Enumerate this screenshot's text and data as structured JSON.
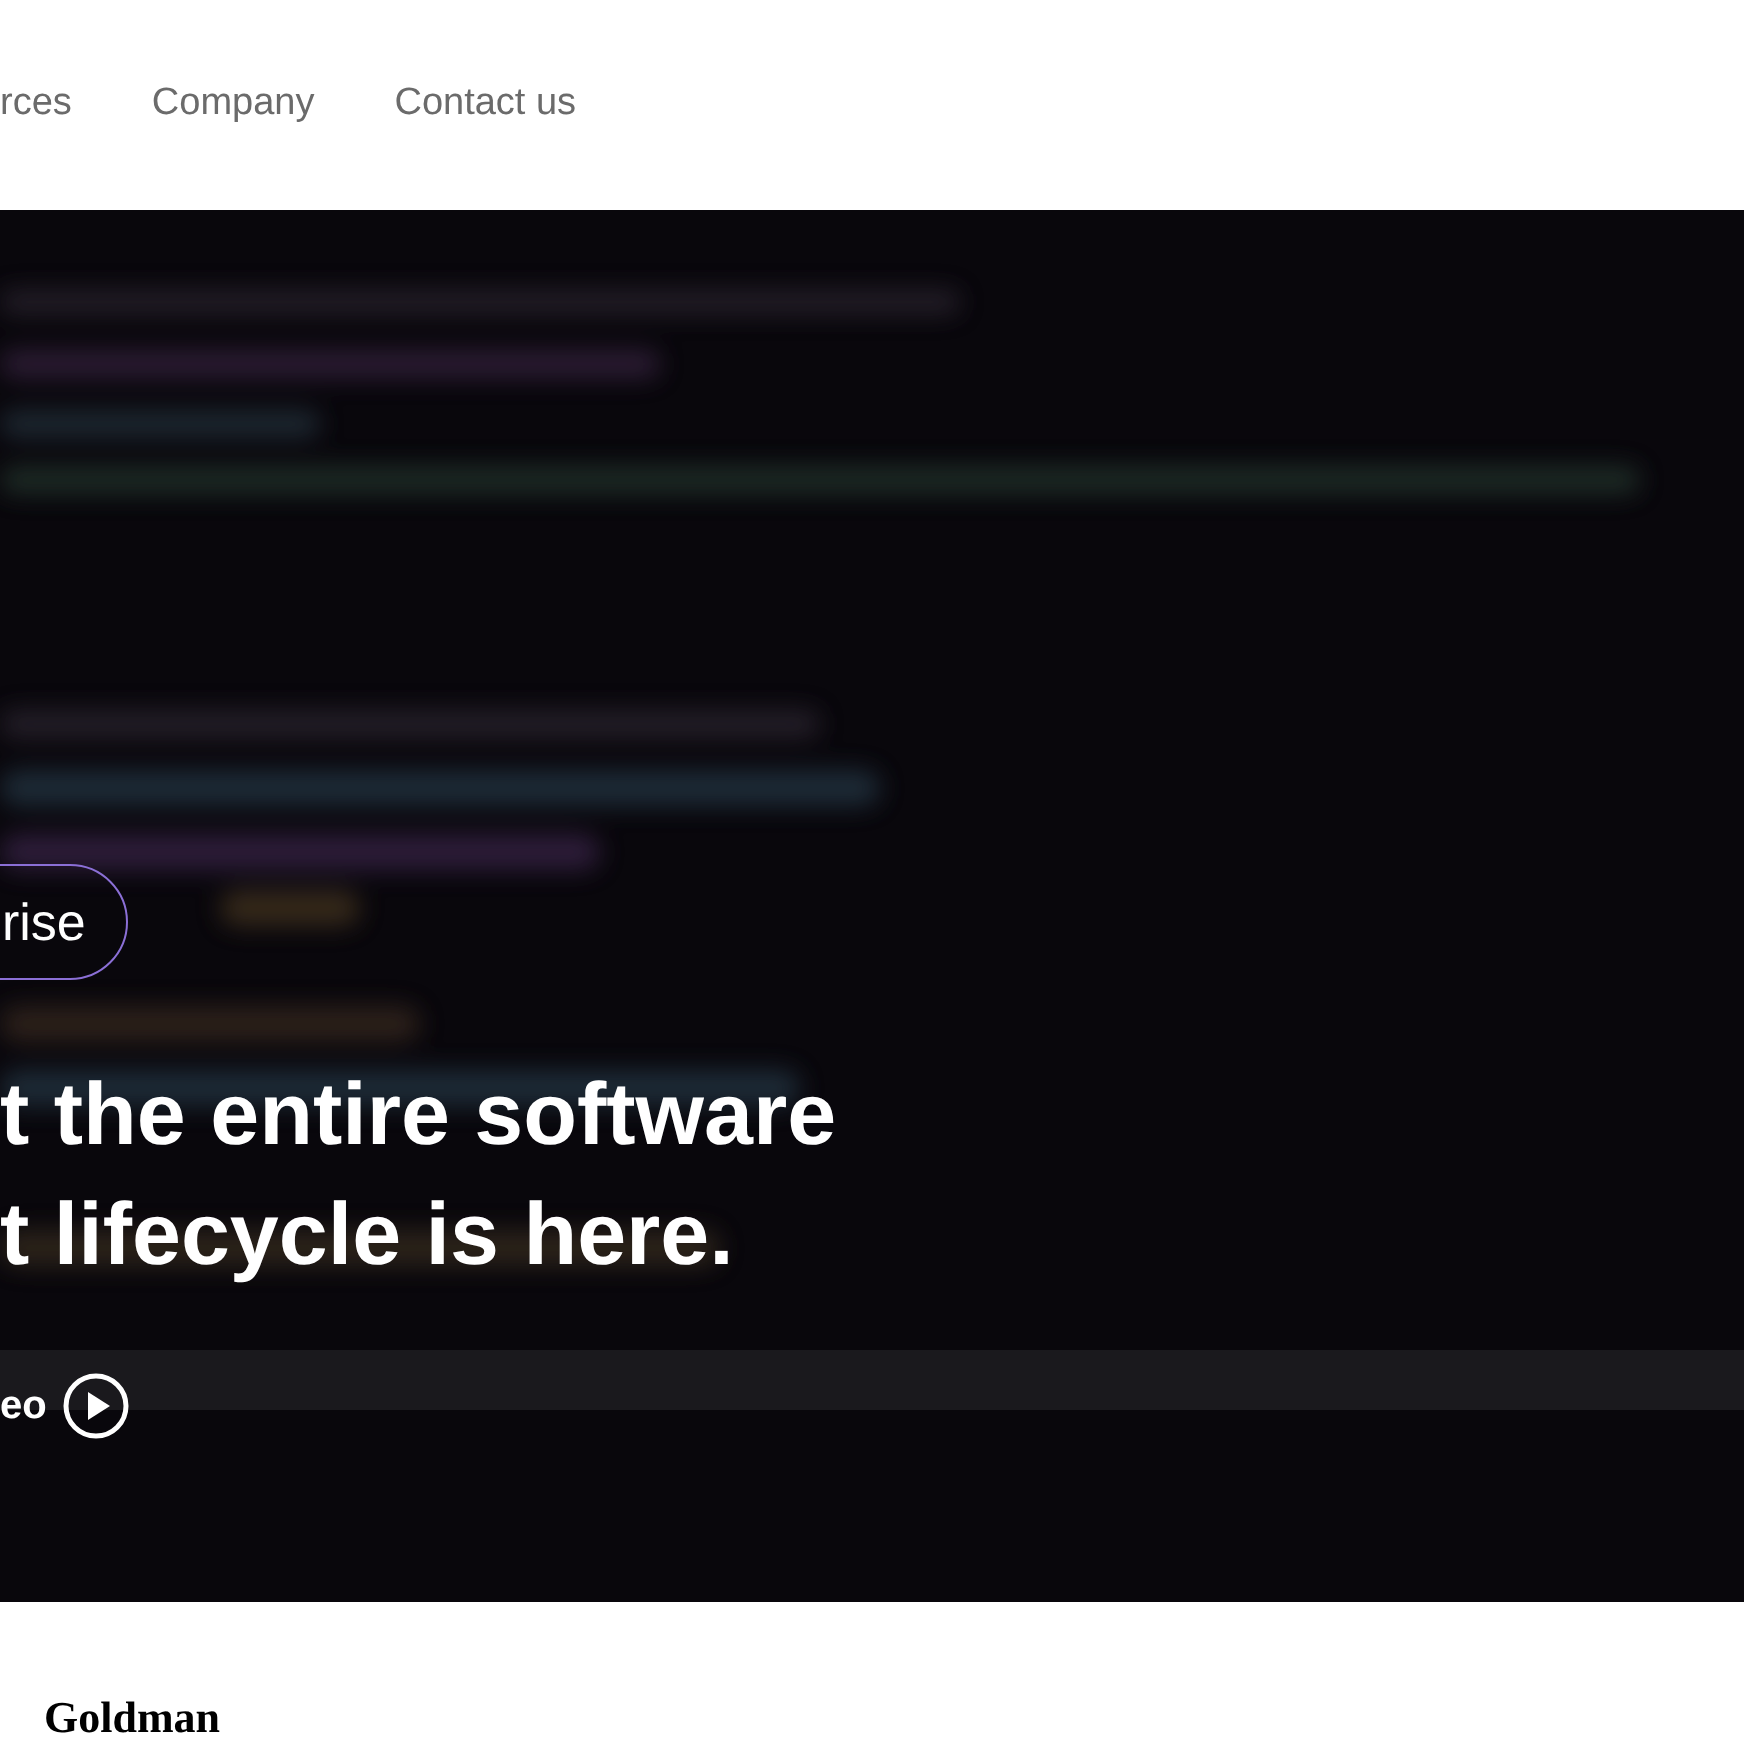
{
  "nav": {
    "links": [
      "rces",
      "Company",
      "Contact us"
    ]
  },
  "hero": {
    "badge": "rise",
    "headline_lines": [
      "t the entire software",
      "t lifecycle is here."
    ],
    "video_button": "eo"
  },
  "logos": [
    "Goldman"
  ]
}
